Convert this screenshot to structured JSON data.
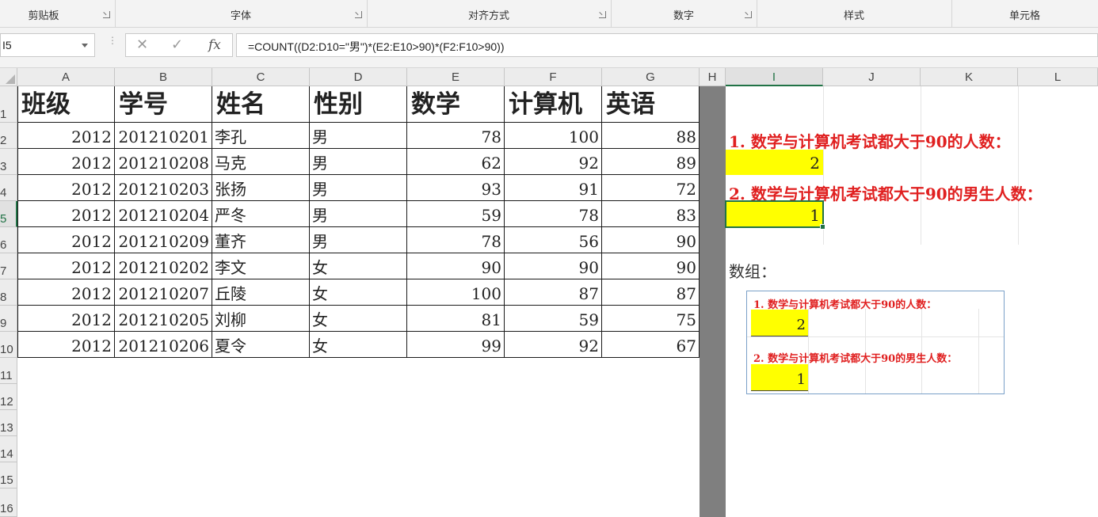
{
  "ribbon": {
    "groups": [
      "剪贴板",
      "字体",
      "对齐方式",
      "数字",
      "样式",
      "单元格"
    ]
  },
  "formula_bar": {
    "name_box": "I5",
    "cancel_symbol": "✕",
    "enter_symbol": "✓",
    "fx_symbol": "fx",
    "formula": "=COUNT((D2:D10=\"男\")*(E2:E10>90)*(F2:F10>90))"
  },
  "columns": [
    "A",
    "B",
    "C",
    "D",
    "E",
    "F",
    "G",
    "H",
    "I",
    "J",
    "K",
    "L"
  ],
  "rows": [
    "1",
    "2",
    "3",
    "4",
    "5",
    "6",
    "7",
    "8",
    "9",
    "10",
    "11",
    "12",
    "13",
    "14",
    "15",
    "16"
  ],
  "table": {
    "headers": [
      "班级",
      "学号",
      "姓名",
      "性别",
      "数学",
      "计算机",
      "英语"
    ],
    "rows": [
      [
        "2012",
        "201210201",
        "李孔",
        "男",
        "78",
        "100",
        "88"
      ],
      [
        "2012",
        "201210208",
        "马克",
        "男",
        "62",
        "92",
        "89"
      ],
      [
        "2012",
        "201210203",
        "张扬",
        "男",
        "93",
        "91",
        "72"
      ],
      [
        "2012",
        "201210204",
        "严冬",
        "男",
        "59",
        "78",
        "83"
      ],
      [
        "2012",
        "201210209",
        "董齐",
        "男",
        "78",
        "56",
        "90"
      ],
      [
        "2012",
        "201210202",
        "李文",
        "女",
        "90",
        "90",
        "90"
      ],
      [
        "2012",
        "201210207",
        "丘陵",
        "女",
        "100",
        "87",
        "87"
      ],
      [
        "2012",
        "201210205",
        "刘柳",
        "女",
        "81",
        "59",
        "75"
      ],
      [
        "2012",
        "201210206",
        "夏令",
        "女",
        "99",
        "92",
        "67"
      ]
    ]
  },
  "results": {
    "q1_label": "1. 数学与计算机考试都大于90的人数：",
    "q1_value": "2",
    "q2_label": "2. 数学与计算机考试都大于90的男生人数：",
    "q2_value": "1",
    "array_label": "数组："
  },
  "picture": {
    "q1_label": "1. 数学与计算机考试都大于90的人数：",
    "q1_value": "2",
    "q2_label": "2. 数学与计算机考试都大于90的男生人数：",
    "q2_value": "1"
  },
  "colors": {
    "highlight": "#ffff00",
    "red_text": "#e02020",
    "selection": "#217346",
    "hidden_column": "#7f7f7f"
  }
}
